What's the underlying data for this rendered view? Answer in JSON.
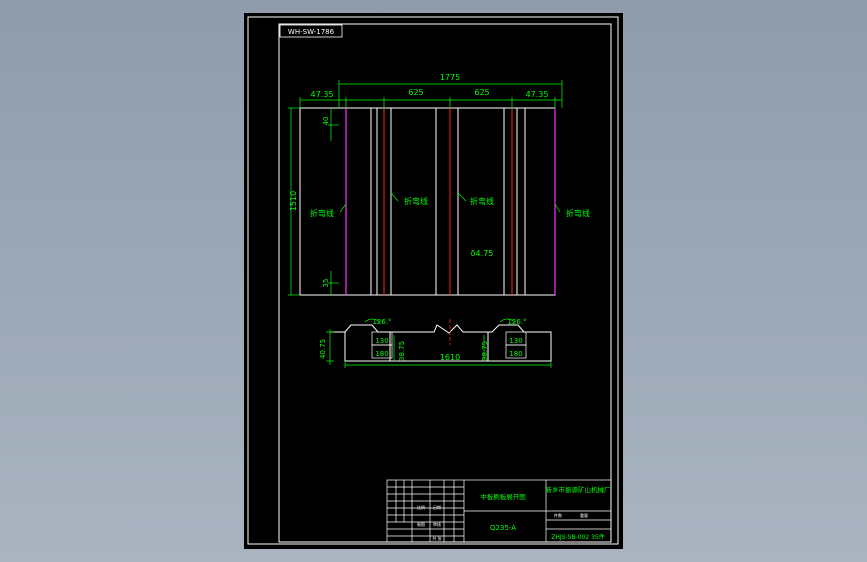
{
  "drawing": {
    "doc_code": "WH-SW-1786",
    "top_view": {
      "overall_width": "1775",
      "edge_left": "47.35",
      "edge_right": "47.35",
      "span_left": "625",
      "span_right": "625",
      "height": "1510",
      "top_margin": "40",
      "bottom_margin": "35",
      "fold_line_label": "折弯线",
      "thickness": "δ4.75"
    },
    "section_view": {
      "angle_left": "126.°",
      "angle_right": "126.°",
      "dim_130": "130",
      "dim_180": "180",
      "depth_left": "40.75",
      "depth_mid": "38.75",
      "depth_right": "38.75",
      "length": "1610"
    },
    "title_block": {
      "part_name": "中板刷板展开图",
      "company": "新乡市振源矿山机械厂",
      "material": "Q235-A",
      "drawing_no": "ZHJS-SB-002  35件",
      "label_scale": "比例",
      "label_date": "日期",
      "label_count": "件数",
      "label_weight": "重量",
      "label_drawn": "制图",
      "label_checked": "审核",
      "label_sheet": "共 张"
    }
  }
}
